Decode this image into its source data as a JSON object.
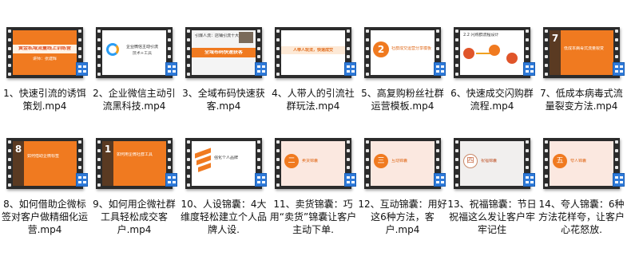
{
  "files": [
    {
      "caption": "1、快速引流的诱饵策划.mp4",
      "thumb_title": "黄金私域流量线上训练营",
      "thumb_sub": "讲师：张建辉"
    },
    {
      "caption": "2、企业微信主动引流黑科技.mp4",
      "thumb_title": "企业微信主动引流",
      "thumb_sub": "技术+工具"
    },
    {
      "caption": "3、全域布码快速获客.mp4",
      "thumb_title": "全域布码快速获客",
      "thumb_sub": "引爆人流：店铺引流十大方法"
    },
    {
      "caption": "4、人带人的引流社群玩法.mp4",
      "thumb_title": "社群裂变",
      "thumb_sub": "人带人玩法，快速成交"
    },
    {
      "caption": "5、高复购粉丝社群运营模板.mp4",
      "thumb_title": "2",
      "thumb_sub": "社群成交运营分享模板"
    },
    {
      "caption": "6、快速成交闪购群流程.mp4",
      "thumb_title": "2.2 闪购群流程设计",
      "thumb_sub": "三步走"
    },
    {
      "caption": "7、低成本病毒式流量裂变方法.mp4",
      "thumb_title": "7",
      "thumb_sub": "低成本病毒式流量裂变"
    },
    {
      "caption": "8、如何借助企微标签对客户做精细化运营.mp4",
      "thumb_title": "8",
      "thumb_sub": "如何借助企微标签"
    },
    {
      "caption": "9、如何用企微社群工具轻松成交客户.mp4",
      "thumb_title": "1",
      "thumb_sub": "如何用企微社群工具"
    },
    {
      "caption": "10、人设锦囊：4大维度轻松建立个人品牌人设.",
      "thumb_title": "强化个人品牌",
      "thumb_sub": ""
    },
    {
      "caption": "11、卖货锦囊：巧用“卖货”锦囊让客户主动下单.",
      "thumb_title": "二",
      "thumb_sub": "卖货锦囊"
    },
    {
      "caption": "12、互动锦囊：用好这6种方法，客户.mp4",
      "thumb_title": "三",
      "thumb_sub": "互动锦囊"
    },
    {
      "caption": "13、祝福锦囊：节日祝福这么发让客户牢牢记住",
      "thumb_title": "四",
      "thumb_sub": "祝福锦囊"
    },
    {
      "caption": "14、夸人锦囊：6种方法花样夸，让客户心花怒放.",
      "thumb_title": "五",
      "thumb_sub": "夸人锦囊"
    }
  ],
  "colors": {
    "accent": "#f07a20",
    "badge": "#2f7ad9"
  },
  "icons": {
    "file_type": "video-file-icon"
  }
}
